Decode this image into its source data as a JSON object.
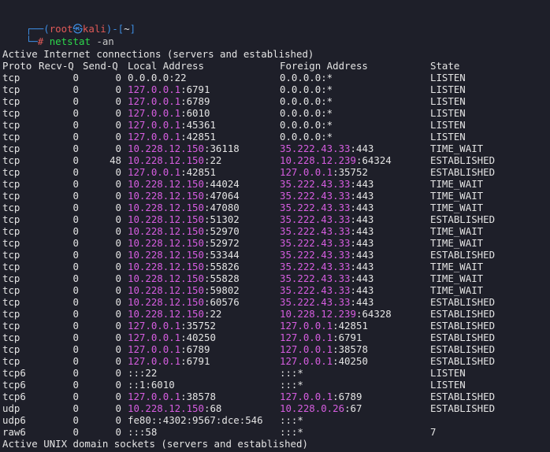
{
  "prompt": {
    "top_prefix": "┌──(",
    "user": "root",
    "at": "㉿",
    "host": "kali",
    "mid": ")-[",
    "cwd": "~",
    "end": "]",
    "bottom_prefix": "└─",
    "hash": "#",
    "command": "netstat",
    "args": "-an"
  },
  "section1_title": "Active Internet connections (servers and established)",
  "headers": {
    "proto": "Proto",
    "recv": "Recv-Q",
    "send": "Send-Q",
    "local": "Local Address",
    "foreign": "Foreign Address",
    "state": "State"
  },
  "rows": [
    {
      "proto": "tcp",
      "recv": "0",
      "send": "0",
      "local_ip": "0.0.0.0",
      "local_hl": false,
      "local_port": ":22",
      "foreign_ip": "0.0.0.0",
      "foreign_hl": false,
      "foreign_port": ":*",
      "state": "LISTEN"
    },
    {
      "proto": "tcp",
      "recv": "0",
      "send": "0",
      "local_ip": "127.0.0.1",
      "local_hl": true,
      "local_port": ":6791",
      "foreign_ip": "0.0.0.0",
      "foreign_hl": false,
      "foreign_port": ":*",
      "state": "LISTEN"
    },
    {
      "proto": "tcp",
      "recv": "0",
      "send": "0",
      "local_ip": "127.0.0.1",
      "local_hl": true,
      "local_port": ":6789",
      "foreign_ip": "0.0.0.0",
      "foreign_hl": false,
      "foreign_port": ":*",
      "state": "LISTEN"
    },
    {
      "proto": "tcp",
      "recv": "0",
      "send": "0",
      "local_ip": "127.0.0.1",
      "local_hl": true,
      "local_port": ":6010",
      "foreign_ip": "0.0.0.0",
      "foreign_hl": false,
      "foreign_port": ":*",
      "state": "LISTEN"
    },
    {
      "proto": "tcp",
      "recv": "0",
      "send": "0",
      "local_ip": "127.0.0.1",
      "local_hl": true,
      "local_port": ":45361",
      "foreign_ip": "0.0.0.0",
      "foreign_hl": false,
      "foreign_port": ":*",
      "state": "LISTEN"
    },
    {
      "proto": "tcp",
      "recv": "0",
      "send": "0",
      "local_ip": "127.0.0.1",
      "local_hl": true,
      "local_port": ":42851",
      "foreign_ip": "0.0.0.0",
      "foreign_hl": false,
      "foreign_port": ":*",
      "state": "LISTEN"
    },
    {
      "proto": "tcp",
      "recv": "0",
      "send": "0",
      "local_ip": "10.228.12.150",
      "local_hl": true,
      "local_port": ":36118",
      "foreign_ip": "35.222.43.33",
      "foreign_hl": true,
      "foreign_port": ":443",
      "state": "TIME_WAIT"
    },
    {
      "proto": "tcp",
      "recv": "0",
      "send": "48",
      "local_ip": "10.228.12.150",
      "local_hl": true,
      "local_port": ":22",
      "foreign_ip": "10.228.12.239",
      "foreign_hl": true,
      "foreign_port": ":64324",
      "state": "ESTABLISHED"
    },
    {
      "proto": "tcp",
      "recv": "0",
      "send": "0",
      "local_ip": "127.0.0.1",
      "local_hl": true,
      "local_port": ":42851",
      "foreign_ip": "127.0.0.1",
      "foreign_hl": true,
      "foreign_port": ":35752",
      "state": "ESTABLISHED"
    },
    {
      "proto": "tcp",
      "recv": "0",
      "send": "0",
      "local_ip": "10.228.12.150",
      "local_hl": true,
      "local_port": ":44024",
      "foreign_ip": "35.222.43.33",
      "foreign_hl": true,
      "foreign_port": ":443",
      "state": "TIME_WAIT"
    },
    {
      "proto": "tcp",
      "recv": "0",
      "send": "0",
      "local_ip": "10.228.12.150",
      "local_hl": true,
      "local_port": ":47064",
      "foreign_ip": "35.222.43.33",
      "foreign_hl": true,
      "foreign_port": ":443",
      "state": "TIME_WAIT"
    },
    {
      "proto": "tcp",
      "recv": "0",
      "send": "0",
      "local_ip": "10.228.12.150",
      "local_hl": true,
      "local_port": ":47080",
      "foreign_ip": "35.222.43.33",
      "foreign_hl": true,
      "foreign_port": ":443",
      "state": "TIME_WAIT"
    },
    {
      "proto": "tcp",
      "recv": "0",
      "send": "0",
      "local_ip": "10.228.12.150",
      "local_hl": true,
      "local_port": ":51302",
      "foreign_ip": "35.222.43.33",
      "foreign_hl": true,
      "foreign_port": ":443",
      "state": "ESTABLISHED"
    },
    {
      "proto": "tcp",
      "recv": "0",
      "send": "0",
      "local_ip": "10.228.12.150",
      "local_hl": true,
      "local_port": ":52970",
      "foreign_ip": "35.222.43.33",
      "foreign_hl": true,
      "foreign_port": ":443",
      "state": "TIME_WAIT"
    },
    {
      "proto": "tcp",
      "recv": "0",
      "send": "0",
      "local_ip": "10.228.12.150",
      "local_hl": true,
      "local_port": ":52972",
      "foreign_ip": "35.222.43.33",
      "foreign_hl": true,
      "foreign_port": ":443",
      "state": "TIME_WAIT"
    },
    {
      "proto": "tcp",
      "recv": "0",
      "send": "0",
      "local_ip": "10.228.12.150",
      "local_hl": true,
      "local_port": ":53344",
      "foreign_ip": "35.222.43.33",
      "foreign_hl": true,
      "foreign_port": ":443",
      "state": "ESTABLISHED"
    },
    {
      "proto": "tcp",
      "recv": "0",
      "send": "0",
      "local_ip": "10.228.12.150",
      "local_hl": true,
      "local_port": ":55826",
      "foreign_ip": "35.222.43.33",
      "foreign_hl": true,
      "foreign_port": ":443",
      "state": "TIME_WAIT"
    },
    {
      "proto": "tcp",
      "recv": "0",
      "send": "0",
      "local_ip": "10.228.12.150",
      "local_hl": true,
      "local_port": ":55828",
      "foreign_ip": "35.222.43.33",
      "foreign_hl": true,
      "foreign_port": ":443",
      "state": "TIME_WAIT"
    },
    {
      "proto": "tcp",
      "recv": "0",
      "send": "0",
      "local_ip": "10.228.12.150",
      "local_hl": true,
      "local_port": ":59802",
      "foreign_ip": "35.222.43.33",
      "foreign_hl": true,
      "foreign_port": ":443",
      "state": "TIME_WAIT"
    },
    {
      "proto": "tcp",
      "recv": "0",
      "send": "0",
      "local_ip": "10.228.12.150",
      "local_hl": true,
      "local_port": ":60576",
      "foreign_ip": "35.222.43.33",
      "foreign_hl": true,
      "foreign_port": ":443",
      "state": "ESTABLISHED"
    },
    {
      "proto": "tcp",
      "recv": "0",
      "send": "0",
      "local_ip": "10.228.12.150",
      "local_hl": true,
      "local_port": ":22",
      "foreign_ip": "10.228.12.239",
      "foreign_hl": true,
      "foreign_port": ":64328",
      "state": "ESTABLISHED"
    },
    {
      "proto": "tcp",
      "recv": "0",
      "send": "0",
      "local_ip": "127.0.0.1",
      "local_hl": true,
      "local_port": ":35752",
      "foreign_ip": "127.0.0.1",
      "foreign_hl": true,
      "foreign_port": ":42851",
      "state": "ESTABLISHED"
    },
    {
      "proto": "tcp",
      "recv": "0",
      "send": "0",
      "local_ip": "127.0.0.1",
      "local_hl": true,
      "local_port": ":40250",
      "foreign_ip": "127.0.0.1",
      "foreign_hl": true,
      "foreign_port": ":6791",
      "state": "ESTABLISHED"
    },
    {
      "proto": "tcp",
      "recv": "0",
      "send": "0",
      "local_ip": "127.0.0.1",
      "local_hl": true,
      "local_port": ":6789",
      "foreign_ip": "127.0.0.1",
      "foreign_hl": true,
      "foreign_port": ":38578",
      "state": "ESTABLISHED"
    },
    {
      "proto": "tcp",
      "recv": "0",
      "send": "0",
      "local_ip": "127.0.0.1",
      "local_hl": true,
      "local_port": ":6791",
      "foreign_ip": "127.0.0.1",
      "foreign_hl": true,
      "foreign_port": ":40250",
      "state": "ESTABLISHED"
    },
    {
      "proto": "tcp6",
      "recv": "0",
      "send": "0",
      "local_ip": "",
      "local_hl": false,
      "local_port": ":::22",
      "foreign_ip": "",
      "foreign_hl": false,
      "foreign_port": ":::*",
      "state": "LISTEN"
    },
    {
      "proto": "tcp6",
      "recv": "0",
      "send": "0",
      "local_ip": "",
      "local_hl": false,
      "local_port": "::1:6010",
      "foreign_ip": "",
      "foreign_hl": false,
      "foreign_port": ":::*",
      "state": "LISTEN"
    },
    {
      "proto": "tcp6",
      "recv": "0",
      "send": "0",
      "local_ip": "127.0.0.1",
      "local_hl": true,
      "local_port": ":38578",
      "foreign_ip": "127.0.0.1",
      "foreign_hl": true,
      "foreign_port": ":6789",
      "state": "ESTABLISHED"
    },
    {
      "proto": "udp",
      "recv": "0",
      "send": "0",
      "local_ip": "10.228.12.150",
      "local_hl": true,
      "local_port": ":68",
      "foreign_ip": "10.228.0.26",
      "foreign_hl": true,
      "foreign_port": ":67",
      "state": "ESTABLISHED"
    },
    {
      "proto": "udp6",
      "recv": "0",
      "send": "0",
      "local_ip": "",
      "local_hl": false,
      "local_port": "fe80::4302:9567:dce:546",
      "foreign_ip": "",
      "foreign_hl": false,
      "foreign_port": ":::*",
      "state": ""
    },
    {
      "proto": "raw6",
      "recv": "0",
      "send": "0",
      "local_ip": "",
      "local_hl": false,
      "local_port": ":::58",
      "foreign_ip": "",
      "foreign_hl": false,
      "foreign_port": ":::*",
      "state": "7"
    }
  ],
  "section2_title": "Active UNIX domain sockets (servers and established)",
  "colors": {
    "background": "#1e1f29",
    "text": "#e4e4e4",
    "prompt_blue": "#3d8ce0",
    "prompt_red": "#e05a58",
    "command_green": "#2dd84c",
    "ip_highlight": "#d65de0"
  }
}
